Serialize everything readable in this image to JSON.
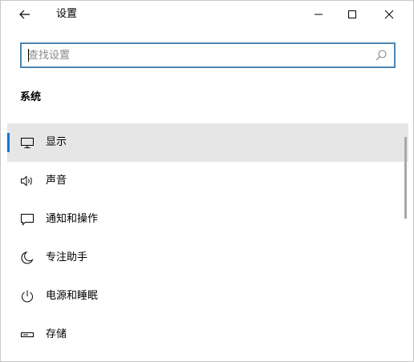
{
  "window": {
    "title": "设置"
  },
  "search": {
    "placeholder": "查找设置",
    "value": ""
  },
  "section": {
    "title": "系统"
  },
  "nav": {
    "items": [
      {
        "label": "显示",
        "icon": "display-icon",
        "selected": true
      },
      {
        "label": "声音",
        "icon": "speaker-icon",
        "selected": false
      },
      {
        "label": "通知和操作",
        "icon": "notification-icon",
        "selected": false
      },
      {
        "label": "专注助手",
        "icon": "moon-icon",
        "selected": false
      },
      {
        "label": "电源和睡眠",
        "icon": "power-icon",
        "selected": false
      },
      {
        "label": "存储",
        "icon": "storage-icon",
        "selected": false
      }
    ]
  },
  "colors": {
    "accent": "#0078d7",
    "search_border": "#4a86b3",
    "selected_bg": "#e6e6e6"
  }
}
